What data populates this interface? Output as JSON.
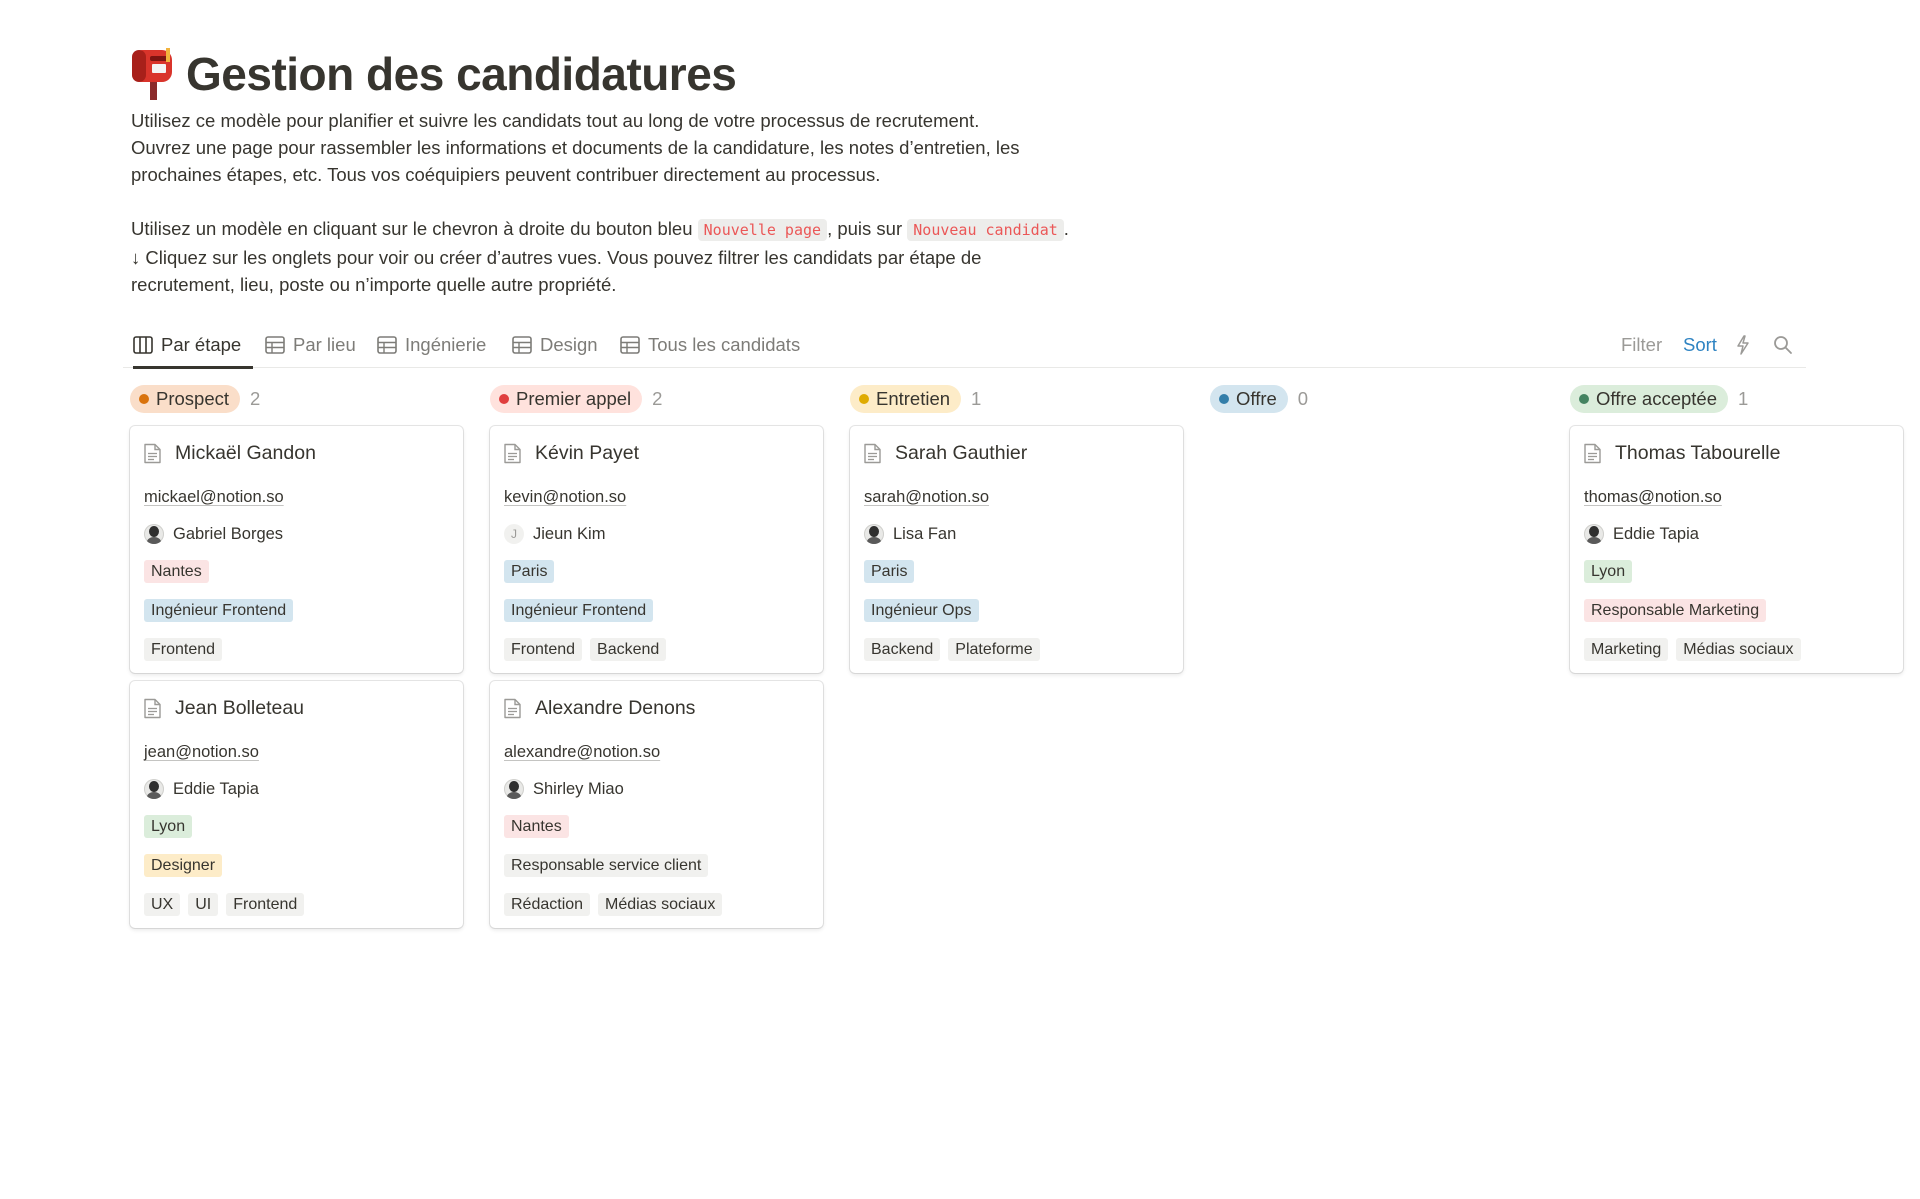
{
  "page": {
    "title": "Gestion des candidatures",
    "description": [
      "Utilisez ce modèle pour planifier et suivre les candidats tout au long de votre processus de recrutement.",
      "Ouvrez une page pour rassembler les informations et documents de la candidature, les notes d’entretien, les",
      "prochaines étapes, etc. Tous vos coéquipiers peuvent contribuer directement au processus."
    ],
    "instructions": {
      "part1": "Utilisez un modèle en cliquant sur le chevron à droite du bouton bleu ",
      "code1": "Nouvelle page",
      "part2": ", puis sur ",
      "code2": "Nouveau candidat",
      "part3": ".",
      "line2": "↓ Cliquez sur les onglets pour voir ou créer d’autres vues. Vous pouvez filtrer les candidats par étape de",
      "line3": "recrutement, lieu, poste ou n’importe quelle autre propriété."
    }
  },
  "tabs": [
    {
      "label": "Par étape",
      "icon": "board-icon",
      "active": true
    },
    {
      "label": "Par lieu",
      "icon": "table-icon",
      "active": false
    },
    {
      "label": "Ingénierie",
      "icon": "table-icon",
      "active": false
    },
    {
      "label": "Design",
      "icon": "table-icon",
      "active": false
    },
    {
      "label": "Tous les candidats",
      "icon": "table-icon",
      "active": false
    }
  ],
  "toolbar": {
    "filter_label": "Filter",
    "sort_label": "Sort",
    "automation_icon": "lightning-icon",
    "search_icon": "search-icon"
  },
  "colors": {
    "sort_link": "#2e83c2"
  },
  "columns": [
    {
      "name": "Prospect",
      "count": "2",
      "pill_bg": "#fadec9",
      "dot": "#d9730d",
      "cards": [
        {
          "name": "Mickaël Gandon",
          "email": "mickael@notion.so",
          "person": "Gabriel Borges",
          "avatar": "photo",
          "location": "Nantes",
          "role": "Ingénieur Frontend",
          "skills": [
            "Frontend"
          ]
        },
        {
          "name": "Jean Bolleteau",
          "email": "jean@notion.so",
          "person": "Eddie Tapia",
          "avatar": "photo",
          "location": "Lyon",
          "role": "Designer",
          "skills": [
            "UX",
            "UI",
            "Frontend"
          ]
        }
      ]
    },
    {
      "name": "Premier appel",
      "count": "2",
      "pill_bg": "#ffe2dd",
      "dot": "#e03e3e",
      "cards": [
        {
          "name": "Kévin Payet",
          "email": "kevin@notion.so",
          "person": "Jieun Kim",
          "avatar": "letter",
          "avatar_letter": "J",
          "location": "Paris",
          "role": "Ingénieur Frontend",
          "skills": [
            "Frontend",
            "Backend"
          ]
        },
        {
          "name": "Alexandre Denons",
          "email": "alexandre@notion.so",
          "person": "Shirley Miao",
          "avatar": "photo",
          "location": "Nantes",
          "role": "Responsable service client",
          "skills": [
            "Rédaction",
            "Médias sociaux"
          ]
        }
      ]
    },
    {
      "name": "Entretien",
      "count": "1",
      "pill_bg": "#fdecc8",
      "dot": "#dfab01",
      "cards": [
        {
          "name": "Sarah Gauthier",
          "email": "sarah@notion.so",
          "person": "Lisa Fan",
          "avatar": "photo",
          "location": "Paris",
          "role": "Ingénieur Ops",
          "skills": [
            "Backend",
            "Plateforme"
          ]
        }
      ]
    },
    {
      "name": "Offre",
      "count": "0",
      "pill_bg": "#d3e5ef",
      "dot": "#337ea9",
      "cards": []
    },
    {
      "name": "Offre acceptée",
      "count": "1",
      "pill_bg": "#dbeddb",
      "dot": "#448361",
      "cards": [
        {
          "name": "Thomas Tabourelle",
          "email": "thomas@notion.so",
          "person": "Eddie Tapia",
          "avatar": "photo",
          "location": "Lyon",
          "role": "Responsable Marketing",
          "skills": [
            "Marketing",
            "Médias sociaux"
          ]
        }
      ]
    }
  ]
}
